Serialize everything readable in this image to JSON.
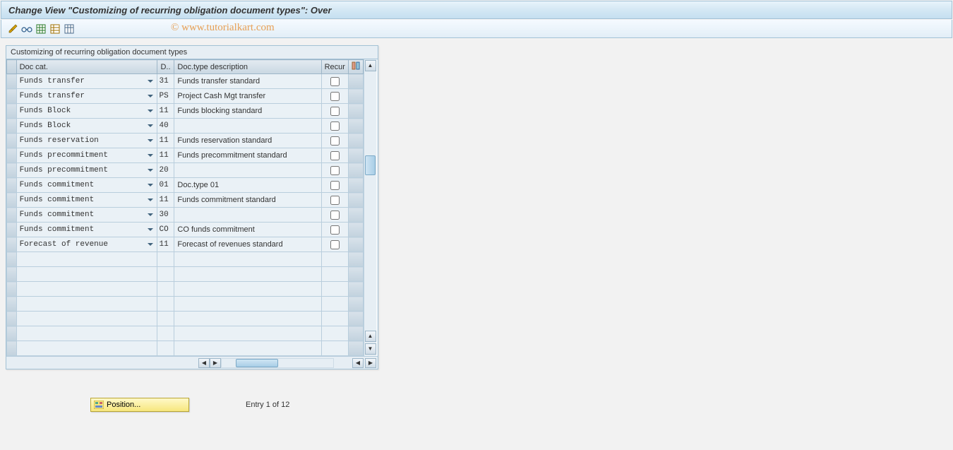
{
  "header": {
    "title": "Change View \"Customizing of recurring obligation document types\": Over"
  },
  "toolbar": {
    "icons": [
      "edit-pencils",
      "glasses",
      "grid-new",
      "grid-copy",
      "grid-delete"
    ]
  },
  "watermark": "© www.tutorialkart.com",
  "table": {
    "caption": "Customizing of recurring obligation document types",
    "columns": {
      "doccat": "Doc cat.",
      "dcode": "D..",
      "desc": "Doc.type description",
      "recur": "Recur"
    },
    "rows": [
      {
        "doccat": "Funds transfer",
        "dcode": "31",
        "desc": "Funds transfer standard",
        "recur": false
      },
      {
        "doccat": "Funds transfer",
        "dcode": "PS",
        "desc": "Project Cash Mgt transfer",
        "recur": false
      },
      {
        "doccat": "Funds Block",
        "dcode": "11",
        "desc": "Funds blocking standard",
        "recur": false
      },
      {
        "doccat": "Funds Block",
        "dcode": "40",
        "desc": "",
        "recur": false
      },
      {
        "doccat": "Funds reservation",
        "dcode": "11",
        "desc": "Funds reservation standard",
        "recur": false
      },
      {
        "doccat": "Funds precommitment",
        "dcode": "11",
        "desc": "Funds precommitment standard",
        "recur": false
      },
      {
        "doccat": "Funds precommitment",
        "dcode": "20",
        "desc": "",
        "recur": false
      },
      {
        "doccat": "Funds commitment",
        "dcode": "01",
        "desc": "Doc.type 01",
        "recur": false
      },
      {
        "doccat": "Funds commitment",
        "dcode": "11",
        "desc": "Funds commitment standard",
        "recur": false
      },
      {
        "doccat": "Funds commitment",
        "dcode": "30",
        "desc": "",
        "recur": false
      },
      {
        "doccat": "Funds commitment",
        "dcode": "CO",
        "desc": "CO funds commitment",
        "recur": false
      },
      {
        "doccat": "Forecast of revenue",
        "dcode": "11",
        "desc": "Forecast of revenues standard",
        "recur": false
      }
    ],
    "empty_rows": 7
  },
  "footer": {
    "position_label": "Position...",
    "status": "Entry 1 of 12"
  }
}
